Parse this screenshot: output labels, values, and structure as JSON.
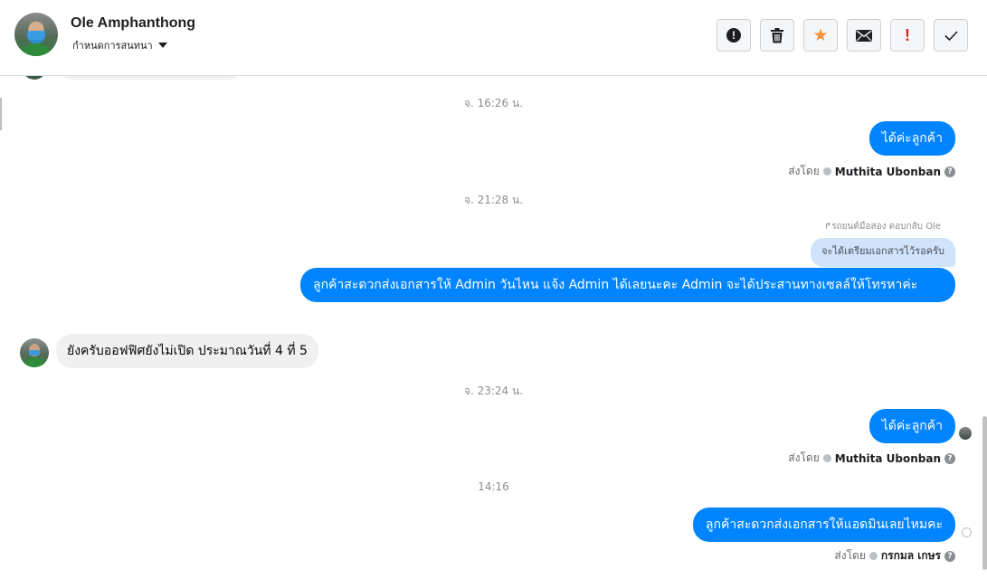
{
  "header": {
    "contact_name": "Ole Amphanthong",
    "assign_label": "กำหนดการสนทนา",
    "toolbar": [
      {
        "name": "spam-button",
        "icon": "alert-circle-icon"
      },
      {
        "name": "delete-button",
        "icon": "trash-icon"
      },
      {
        "name": "star-button",
        "icon": "star-icon"
      },
      {
        "name": "mark-unread-button",
        "icon": "envelope-icon"
      },
      {
        "name": "important-button",
        "icon": "exclamation-icon"
      },
      {
        "name": "done-button",
        "icon": "check-icon"
      }
    ]
  },
  "colors": {
    "outgoing_bubble": "#0084ff",
    "incoming_bubble": "#f0f0f0",
    "reply_bubble": "#cfe3fb",
    "star": "#f7923a",
    "important": "#e02020"
  },
  "conversation": {
    "ts1": "จ. 16:26 น.",
    "msg1": "ได้ค่ะลูกค้า",
    "sentby_prefix": "ส่งโดย",
    "sender1": "Muthita Ubonban",
    "ts2": "จ. 21:28 น.",
    "reply_label": "รถยนต์มือสอง ตอบกลับ Ole",
    "reply_quote": "จะได้เตรียมเอกสารไว้รอครับ",
    "msg2": "ลูกค้าสะดวกส่งเอกสารให้ Admin วันไหน แจ้ง Admin ได้เลยนะคะ Admin จะได้ประสานทางเซลล์ให้โทรหาค่ะ",
    "msg3_in": "ยังครับออฟฟิศยังไม่เปิด ประมาณวันที่ 4 ที่ 5",
    "ts3": "จ. 23:24 น.",
    "msg4": "ได้ค่ะลูกค้า",
    "sender2": "Muthita Ubonban",
    "ts4": "14:16",
    "msg5": "ลูกค้าสะดวกส่งเอกสารให้แอดมินเลยไหมคะ",
    "sender3": "กรกมล เกษร"
  }
}
